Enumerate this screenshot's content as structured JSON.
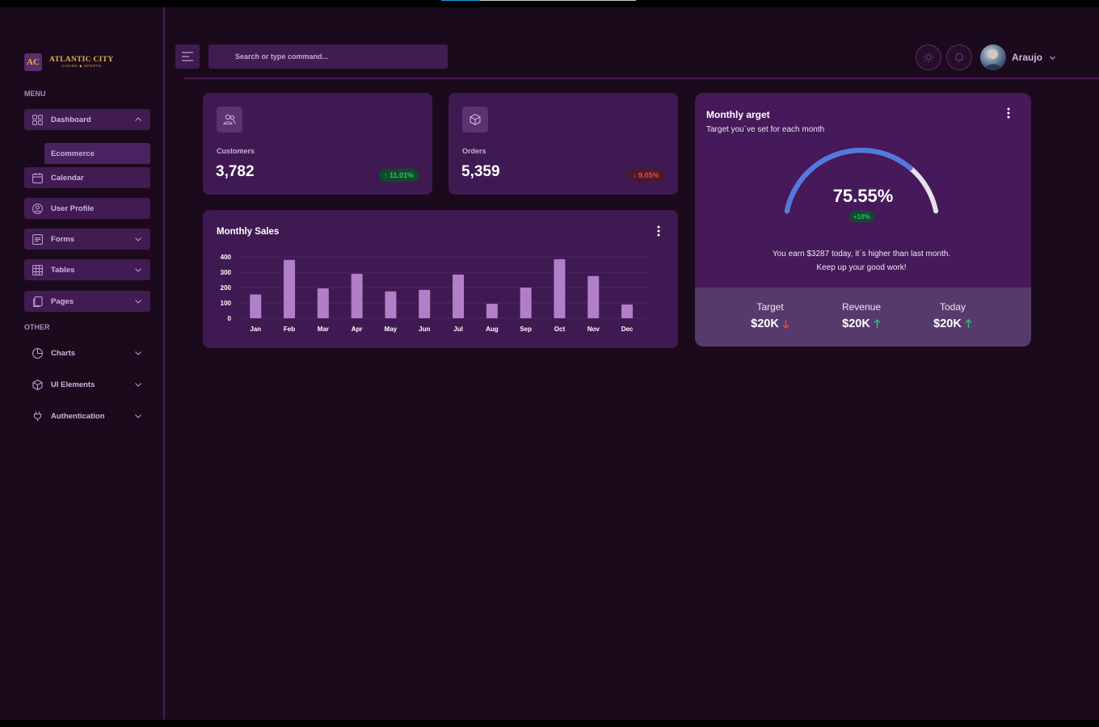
{
  "brand": {
    "logo_initials": "AC",
    "name": "ATLANTIC CITY",
    "tagline": "CASINO ◆ SPORTS"
  },
  "sidebar": {
    "menu_label": "MENU",
    "other_label": "OTHER",
    "items": [
      {
        "label": "Dashboard",
        "icon": "grid-icon"
      },
      {
        "label": "Ecommerce"
      },
      {
        "label": "Calendar",
        "icon": "calendar-icon"
      },
      {
        "label": "User Profile",
        "icon": "user-circle-icon"
      },
      {
        "label": "Forms",
        "icon": "form-icon"
      },
      {
        "label": "Tables",
        "icon": "table-icon"
      },
      {
        "label": "Pages",
        "icon": "pages-icon"
      },
      {
        "label": "Charts",
        "icon": "pie-chart-icon"
      },
      {
        "label": "UI Elements",
        "icon": "cube-icon"
      },
      {
        "label": "Authentication",
        "icon": "plug-icon"
      }
    ]
  },
  "header": {
    "search_placeholder": "Search or type command...",
    "user_name": "Araujo"
  },
  "stats": [
    {
      "label": "Customers",
      "value": "3,782",
      "change": "↑ 11.01%",
      "trend": "up"
    },
    {
      "label": "Orders",
      "value": "5,359",
      "change": "↓ 9.05%",
      "trend": "down"
    }
  ],
  "monthly_sales": {
    "title": "Monthly Sales"
  },
  "chart_data": {
    "type": "bar",
    "title": "Monthly Sales",
    "categories": [
      "Jan",
      "Feb",
      "Mar",
      "Apr",
      "May",
      "Jun",
      "Jul",
      "Aug",
      "Sep",
      "Oct",
      "Nov",
      "Dec"
    ],
    "values": [
      155,
      380,
      195,
      290,
      175,
      185,
      285,
      95,
      200,
      385,
      275,
      90
    ],
    "yticks": [
      "400",
      "300",
      "200",
      "100",
      "0"
    ],
    "ylim": [
      0,
      400
    ],
    "bar_color": "#b17fc8"
  },
  "monthly_target": {
    "title": "Monthly arget",
    "subtitle": "Target you´ve set for each month",
    "percent_label": "75.55%",
    "percent": 75.55,
    "badge": "+10%",
    "message_line1": "You earn $3287 today, it´s higher than last month.",
    "message_line2": "Keep up your good work!",
    "kpis": [
      {
        "label": "Target",
        "value": "$20K",
        "trend": "down"
      },
      {
        "label": "Revenue",
        "value": "$20K",
        "trend": "up"
      },
      {
        "label": "Today",
        "value": "$20K",
        "trend": "up"
      }
    ]
  },
  "colors": {
    "accent": "#5a3aa8",
    "gauge": "#4f7be0",
    "up": "#2ec26d",
    "down": "#f0483e"
  }
}
